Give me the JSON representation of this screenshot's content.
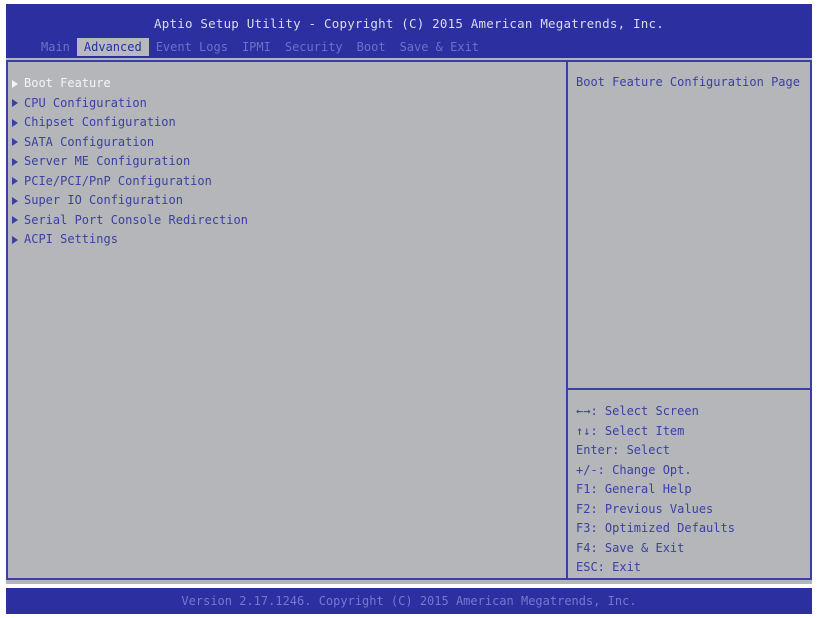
{
  "header": {
    "title": "Aptio Setup Utility - Copyright (C) 2015 American Megatrends, Inc.",
    "tabs": [
      {
        "label": "Main"
      },
      {
        "label": "Advanced"
      },
      {
        "label": "Event Logs"
      },
      {
        "label": "IPMI"
      },
      {
        "label": "Security"
      },
      {
        "label": "Boot"
      },
      {
        "label": "Save & Exit"
      }
    ],
    "active_tab": "Advanced"
  },
  "menu": {
    "items": [
      {
        "label": "Boot Feature"
      },
      {
        "label": "CPU Configuration"
      },
      {
        "label": "Chipset Configuration"
      },
      {
        "label": "SATA Configuration"
      },
      {
        "label": "Server ME Configuration"
      },
      {
        "label": "PCIe/PCI/PnP Configuration"
      },
      {
        "label": "Super IO Configuration"
      },
      {
        "label": "Serial Port Console Redirection"
      },
      {
        "label": "ACPI Settings"
      }
    ],
    "selected_index": 0
  },
  "help": {
    "text": "Boot Feature Configuration Page"
  },
  "keys": {
    "lines": [
      "←→: Select Screen",
      "↑↓: Select Item",
      "Enter: Select",
      "+/-: Change Opt.",
      "F1: General Help",
      "F2: Previous Values",
      "F3: Optimized Defaults",
      "F4: Save & Exit",
      "ESC: Exit"
    ]
  },
  "footer": {
    "text": "Version 2.17.1246. Copyright (C) 2015 American Megatrends, Inc."
  },
  "colors": {
    "header_bg": "#2b2f9f",
    "panel_bg": "#b4b6ba",
    "text": "#3c40a2",
    "selected_text": "#f4f4f6",
    "border": "#3a3fa0"
  }
}
